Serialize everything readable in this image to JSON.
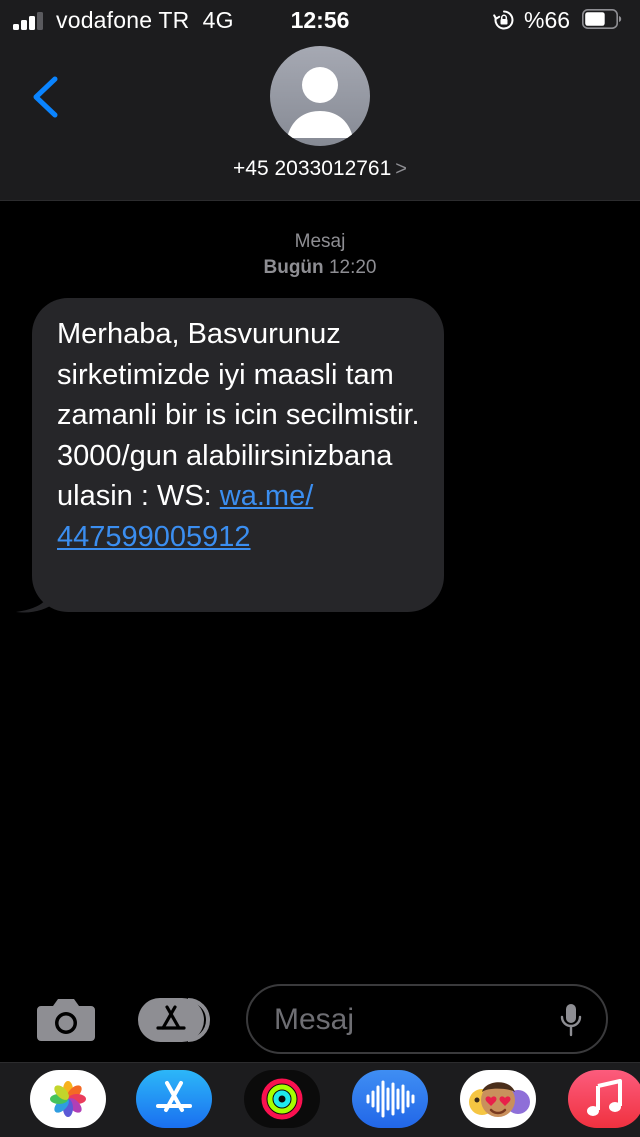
{
  "status_bar": {
    "carrier": "vodafone TR",
    "network": "4G",
    "time": "12:56",
    "battery_percent_label": "%66",
    "battery_level": 0.66,
    "signal_bars": 3,
    "icons": [
      "signal-icon",
      "rotation-lock-icon",
      "battery-icon"
    ]
  },
  "header": {
    "back_icon": "chevron-left-icon",
    "avatar_icon": "person-silhouette-icon",
    "contact": "+45 2033012761",
    "contact_chevron": ">"
  },
  "thread": {
    "service": "Mesaj",
    "date_label": "Bugün",
    "time_label": "12:20",
    "message": {
      "text": "Merhaba, Basvurunuz sirketimizde iyi maasli tam zamanli bir is icin secilmistir. 3000/gun alabilirsinizbana ulasin : WS: ",
      "link_text": "wa.me/\n447599005912"
    }
  },
  "composer": {
    "camera_icon": "camera-icon",
    "apps_icon": "app-store-icon",
    "placeholder": "Mesaj",
    "mic_icon": "microphone-icon"
  },
  "app_drawer": {
    "apps": [
      "photos-app-icon",
      "app-store-app-icon",
      "activity-app-icon",
      "audio-message-app-icon",
      "memoji-app-icon",
      "music-app-icon"
    ]
  },
  "colors": {
    "background": "#000000",
    "bar_background": "#1c1c1e",
    "bubble_incoming": "#262629",
    "accent_blue": "#0a84ff",
    "link_blue": "#3b8ef0",
    "secondary_text": "#8e8e93"
  }
}
